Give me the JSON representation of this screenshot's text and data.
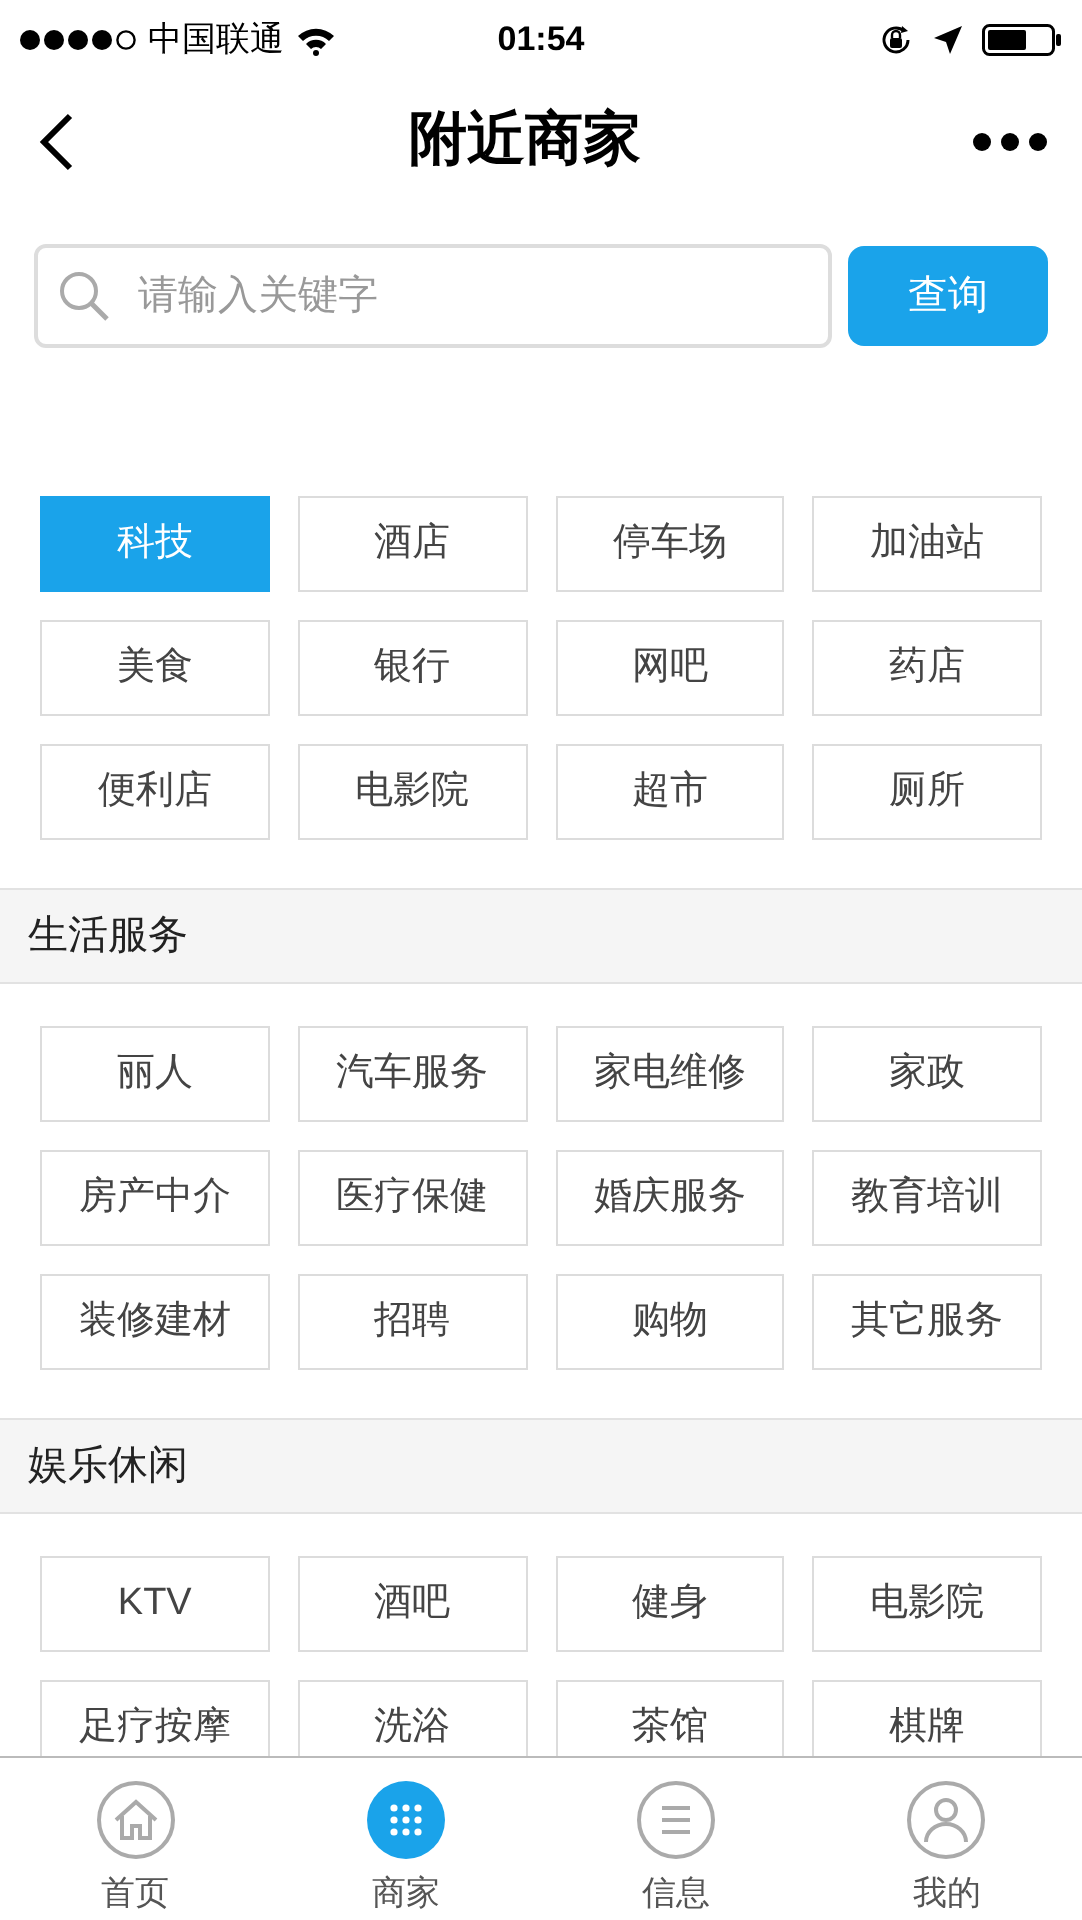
{
  "status_bar": {
    "carrier": "中国联通",
    "time": "01:54"
  },
  "nav": {
    "title": "附近商家"
  },
  "search": {
    "placeholder": "请输入关键字",
    "button": "查询"
  },
  "sections": [
    {
      "items": [
        {
          "label": "科技",
          "selected": true
        },
        {
          "label": "酒店",
          "selected": false
        },
        {
          "label": "停车场",
          "selected": false
        },
        {
          "label": "加油站",
          "selected": false
        },
        {
          "label": "美食",
          "selected": false
        },
        {
          "label": "银行",
          "selected": false
        },
        {
          "label": "网吧",
          "selected": false
        },
        {
          "label": "药店",
          "selected": false
        },
        {
          "label": "便利店",
          "selected": false
        },
        {
          "label": "电影院",
          "selected": false
        },
        {
          "label": "超市",
          "selected": false
        },
        {
          "label": "厕所",
          "selected": false
        }
      ]
    },
    {
      "title": "生活服务",
      "items": [
        {
          "label": "丽人",
          "selected": false
        },
        {
          "label": "汽车服务",
          "selected": false
        },
        {
          "label": "家电维修",
          "selected": false
        },
        {
          "label": "家政",
          "selected": false
        },
        {
          "label": "房产中介",
          "selected": false
        },
        {
          "label": "医疗保健",
          "selected": false
        },
        {
          "label": "婚庆服务",
          "selected": false
        },
        {
          "label": "教育培训",
          "selected": false
        },
        {
          "label": "装修建材",
          "selected": false
        },
        {
          "label": "招聘",
          "selected": false
        },
        {
          "label": "购物",
          "selected": false
        },
        {
          "label": "其它服务",
          "selected": false
        }
      ]
    },
    {
      "title": "娱乐休闲",
      "items": [
        {
          "label": "KTV",
          "selected": false
        },
        {
          "label": "酒吧",
          "selected": false
        },
        {
          "label": "健身",
          "selected": false
        },
        {
          "label": "电影院",
          "selected": false
        },
        {
          "label": "足疗按摩",
          "selected": false
        },
        {
          "label": "洗浴",
          "selected": false
        },
        {
          "label": "茶馆",
          "selected": false
        },
        {
          "label": "棋牌",
          "selected": false
        }
      ]
    }
  ],
  "tab_bar": [
    {
      "label": "首页",
      "selected": false
    },
    {
      "label": "商家",
      "selected": true
    },
    {
      "label": "信息",
      "selected": false
    },
    {
      "label": "我的",
      "selected": false
    }
  ]
}
